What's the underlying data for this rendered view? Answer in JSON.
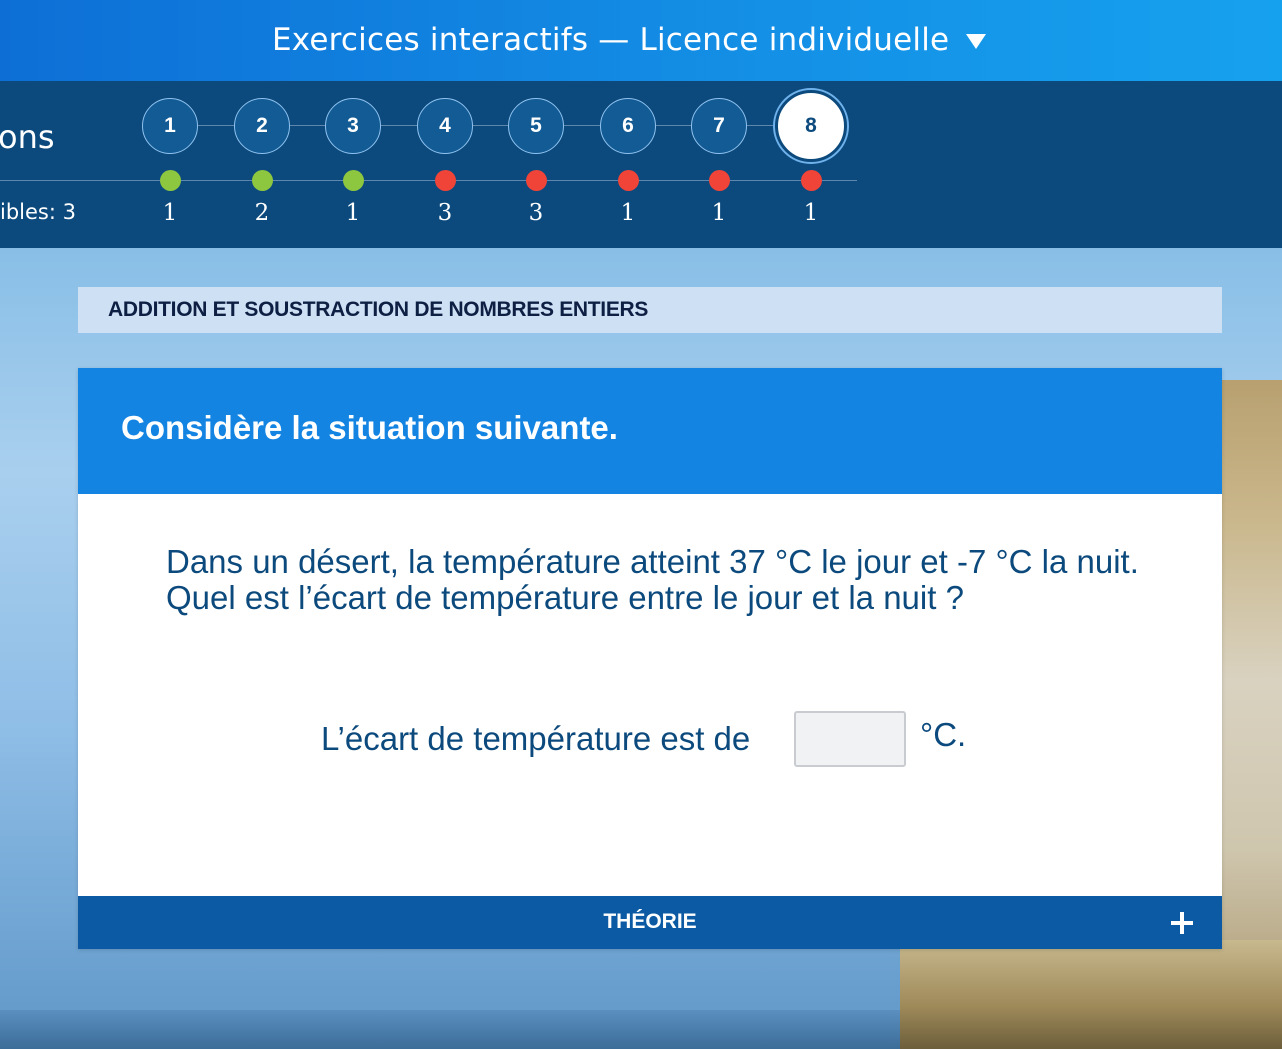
{
  "header": {
    "title": "Exercices interactifs — Licence individuelle",
    "menu_icon": "caret-down-icon"
  },
  "progress": {
    "section_fragment": "ons",
    "attempts_fragment": "ibles: 3",
    "current_step": 8,
    "steps": [
      {
        "number": "1",
        "status": "correct",
        "tries": "1"
      },
      {
        "number": "2",
        "status": "correct",
        "tries": "2"
      },
      {
        "number": "3",
        "status": "correct",
        "tries": "1"
      },
      {
        "number": "4",
        "status": "incorrect",
        "tries": "3"
      },
      {
        "number": "5",
        "status": "incorrect",
        "tries": "3"
      },
      {
        "number": "6",
        "status": "incorrect",
        "tries": "1"
      },
      {
        "number": "7",
        "status": "incorrect",
        "tries": "1"
      },
      {
        "number": "8",
        "status": "incorrect",
        "tries": "1"
      }
    ],
    "colors": {
      "correct": "#8dc63f",
      "incorrect": "#f04438"
    }
  },
  "topic": {
    "title": "ADDITION ET SOUSTRACTION DE NOMBRES ENTIERS"
  },
  "exercise": {
    "header": "Considère la situation suivante.",
    "question": "Dans un désert, la température atteint 37 °C le jour et -7 °C la nuit. Quel est l’écart de température entre le jour et la nuit ?",
    "answer_label": "L’écart de température est de",
    "answer_value": "",
    "answer_unit": "°C."
  },
  "theory": {
    "label": "THÉORIE",
    "icon": "plus-icon"
  }
}
